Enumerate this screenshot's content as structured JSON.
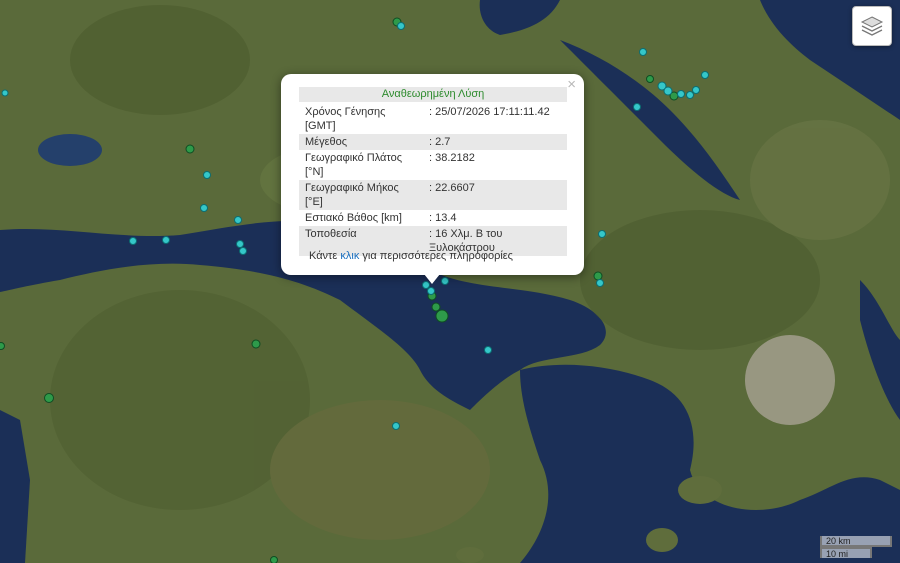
{
  "popup": {
    "title": "Αναθεωρημένη Λύση",
    "close_symbol": "×",
    "rows": [
      {
        "key": "Χρόνος Γένησης [GMT]",
        "value": ": 25/07/2026 17:11:11.42"
      },
      {
        "key": "Μέγεθος",
        "value": ": 2.7"
      },
      {
        "key": "Γεωγραφικό Πλάτος [°N]",
        "value": ": 38.2182"
      },
      {
        "key": "Γεωγραφικό Μήκος [°E]",
        "value": ": 22.6607"
      },
      {
        "key": "Εστιακό Βάθος [km]",
        "value": ": 13.4"
      },
      {
        "key": "Τοποθεσία",
        "value": ": 16 Χλμ. Β του Ξυλοκάστρου"
      }
    ],
    "more_prefix": "Κάντε ",
    "more_link": "κλικ",
    "more_suffix": " για περισσότερες πληροφορίες"
  },
  "scale": {
    "km": "20 km",
    "mi": "10 mi"
  },
  "layers_control": {
    "icon": "layers-icon"
  },
  "colors": {
    "sea": "#1b2f57",
    "recent_marker": "#35c7c9",
    "older_marker": "#2e9a4a"
  }
}
